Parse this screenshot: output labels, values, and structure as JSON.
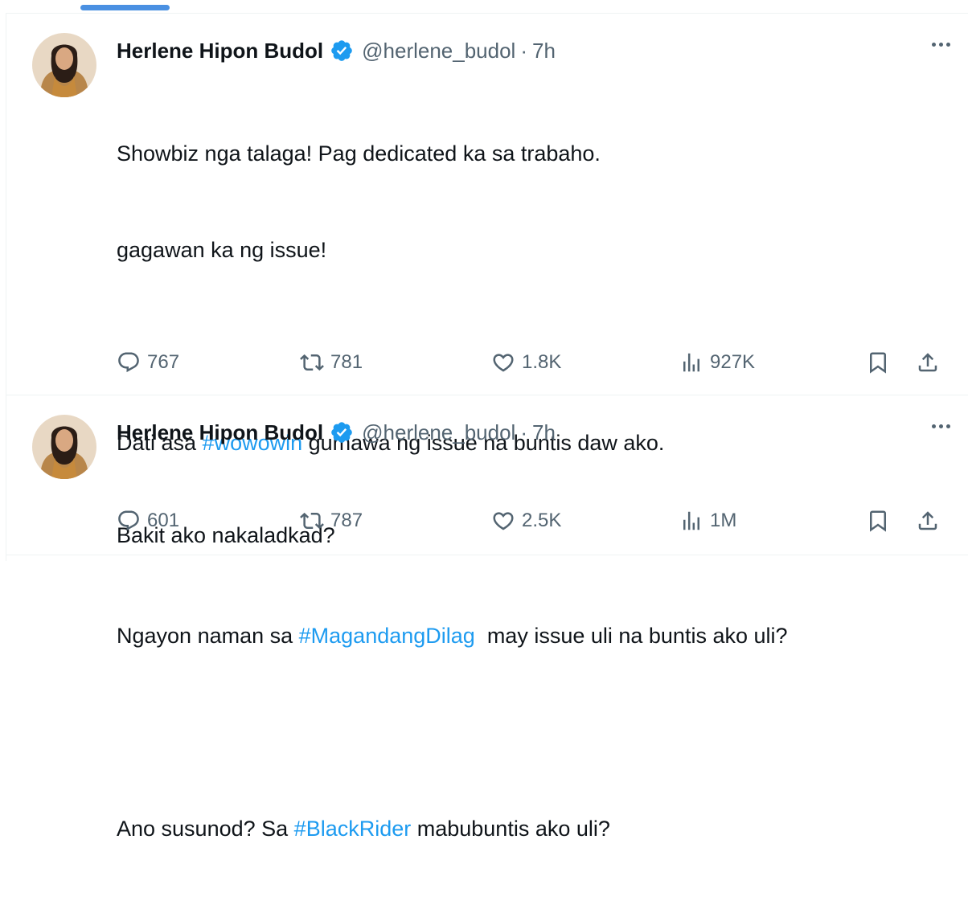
{
  "colors": {
    "accent": "#1d9bf0",
    "verified": "#1d9bf0",
    "secondary_text": "#536471",
    "primary_text": "#0f1419",
    "tab_indicator": "#4a90e2"
  },
  "tweets": [
    {
      "author_name": "Herlene Hipon Budol",
      "handle": "@herlene_budol",
      "separator": "·",
      "time": "7h",
      "lines": {
        "l1": "Showbiz nga talaga! Pag dedicated ka sa trabaho.",
        "l2": "gagawan ka ng issue!",
        "l3_pre": "Dati asa ",
        "l3_tag": "#wowowin",
        "l3_post": " gumawa ng issue na buntis daw ako.",
        "l4_pre": "Ngayon naman sa ",
        "l4_tag": "#MagandangDilag",
        "l4_post": "  may issue uli na buntis ako uli?",
        "l5_pre": "Ano susunod? Sa ",
        "l5_tag": "#BlackRider",
        "l5_post": " mabubuntis ako uli?"
      },
      "stats": {
        "replies": "767",
        "retweets": "781",
        "likes": "1.8K",
        "views": "927K"
      }
    },
    {
      "author_name": "Herlene Hipon Budol",
      "handle": "@herlene_budol",
      "separator": "·",
      "time": "7h",
      "text": "Bakit ako nakaladkad?",
      "stats": {
        "replies": "601",
        "retweets": "787",
        "likes": "2.5K",
        "views": "1M"
      }
    }
  ],
  "icons": {
    "reply": "reply-icon",
    "retweet": "retweet-icon",
    "like": "heart-icon",
    "views": "views-chart-icon",
    "bookmark": "bookmark-icon",
    "share": "share-icon",
    "verified": "verified-badge-icon",
    "more": "more-options-icon"
  }
}
